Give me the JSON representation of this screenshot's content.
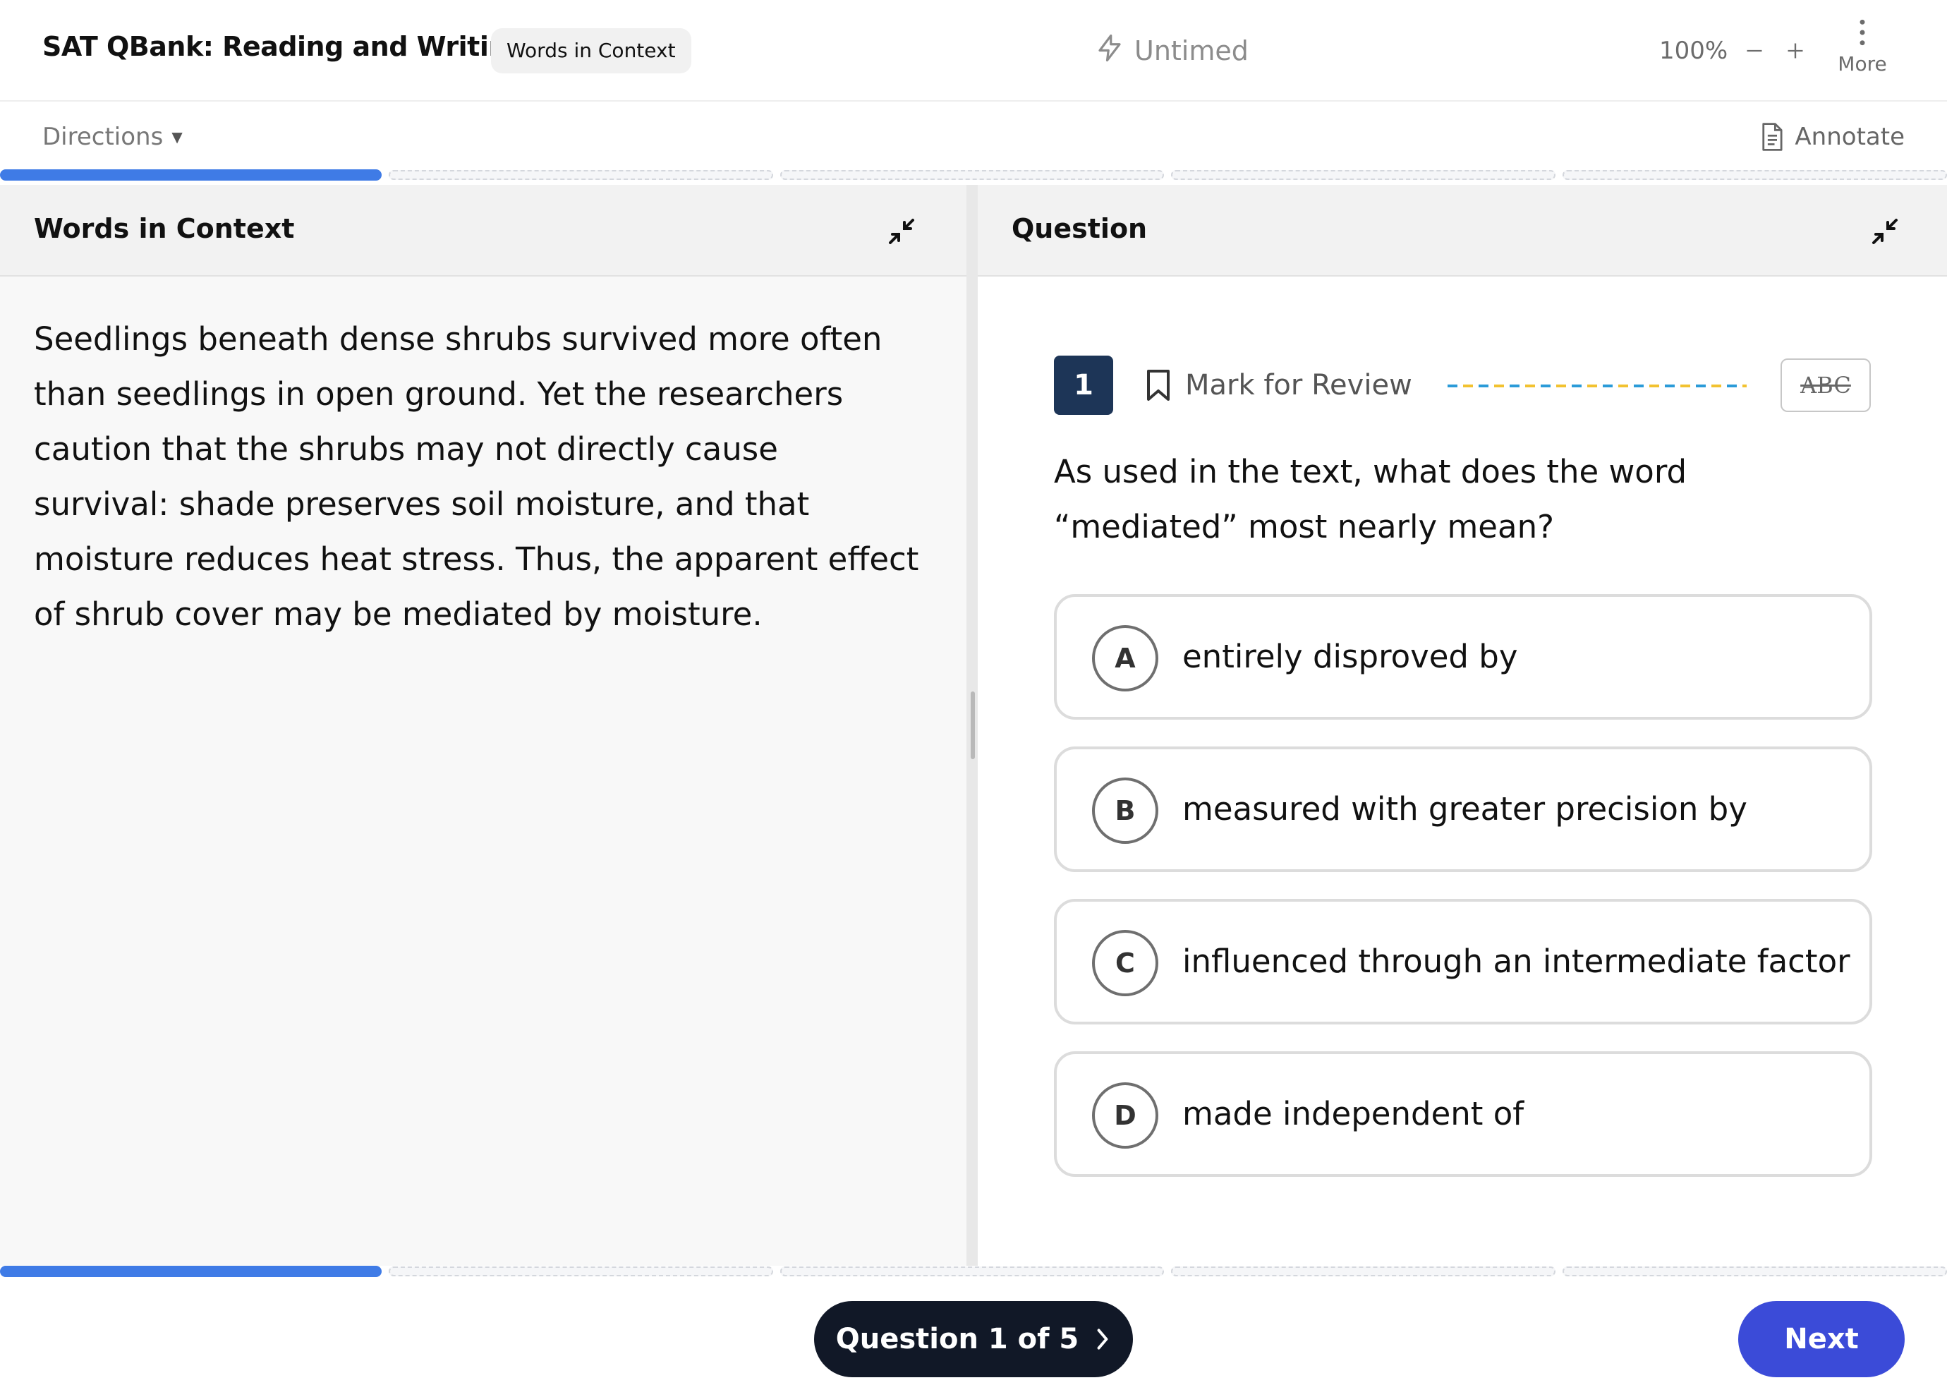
{
  "header": {
    "title": "SAT QBank: Reading and Writing",
    "section_badge": "Words in Context",
    "timer_label": "Untimed",
    "timer_icon": "lightning-icon",
    "zoom_level": "100%",
    "more_label": "More"
  },
  "subheader": {
    "directions_label": "Directions",
    "annotate_label": "Annotate"
  },
  "progress": {
    "segments_total": 5,
    "segments_completed": 1
  },
  "passage_pane": {
    "title": "Words in Context",
    "text": "Seedlings beneath dense shrubs survived more often than seedlings in open ground. Yet the researchers caution that the shrubs may not directly cause survival: shade preserves soil moisture, and that moisture reduces heat stress. Thus, the apparent effect of shrub cover may be mediated by moisture."
  },
  "question_pane": {
    "title": "Question",
    "number": "1",
    "mark_for_review_label": "Mark for Review",
    "strikethrough_label": "ABC",
    "stem": "As used in the text, what does the word “mediated” most nearly mean?",
    "choices": [
      {
        "letter": "A",
        "text": "entirely disproved by"
      },
      {
        "letter": "B",
        "text": "measured with greater precision by"
      },
      {
        "letter": "C",
        "text": "influenced through an intermediate factor"
      },
      {
        "letter": "D",
        "text": "made independent of"
      }
    ]
  },
  "footer": {
    "question_nav_label": "Question 1 of 5",
    "next_label": "Next"
  },
  "colors": {
    "progress_fill": "#3f7be6",
    "question_number_bg": "#1d3557",
    "nav_button_bg": "#111827",
    "next_button_bg": "#3b4bd8"
  }
}
